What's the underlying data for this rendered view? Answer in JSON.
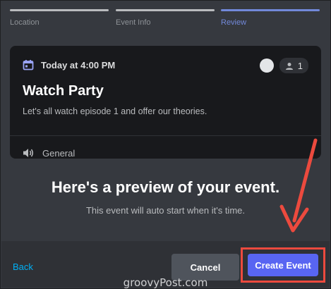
{
  "stepper": {
    "steps": [
      {
        "label": "Location"
      },
      {
        "label": "Event Info"
      },
      {
        "label": "Review"
      }
    ],
    "active_index": 2
  },
  "card": {
    "date_text": "Today at 4:00 PM",
    "interested_count": "1",
    "title": "Watch Party",
    "description": "Let's all watch episode 1 and offer our theories.",
    "channel_name": "General"
  },
  "preview": {
    "headline": "Here's a preview of your event.",
    "subline": "This event will auto start when it's time."
  },
  "footer": {
    "back_label": "Back",
    "cancel_label": "Cancel",
    "create_label": "Create Event",
    "watermark": "groovyPost.com"
  },
  "colors": {
    "accent": "#5865f2",
    "active_step": "#7289da",
    "annotation": "#ec4a3e",
    "link": "#00aff4"
  }
}
